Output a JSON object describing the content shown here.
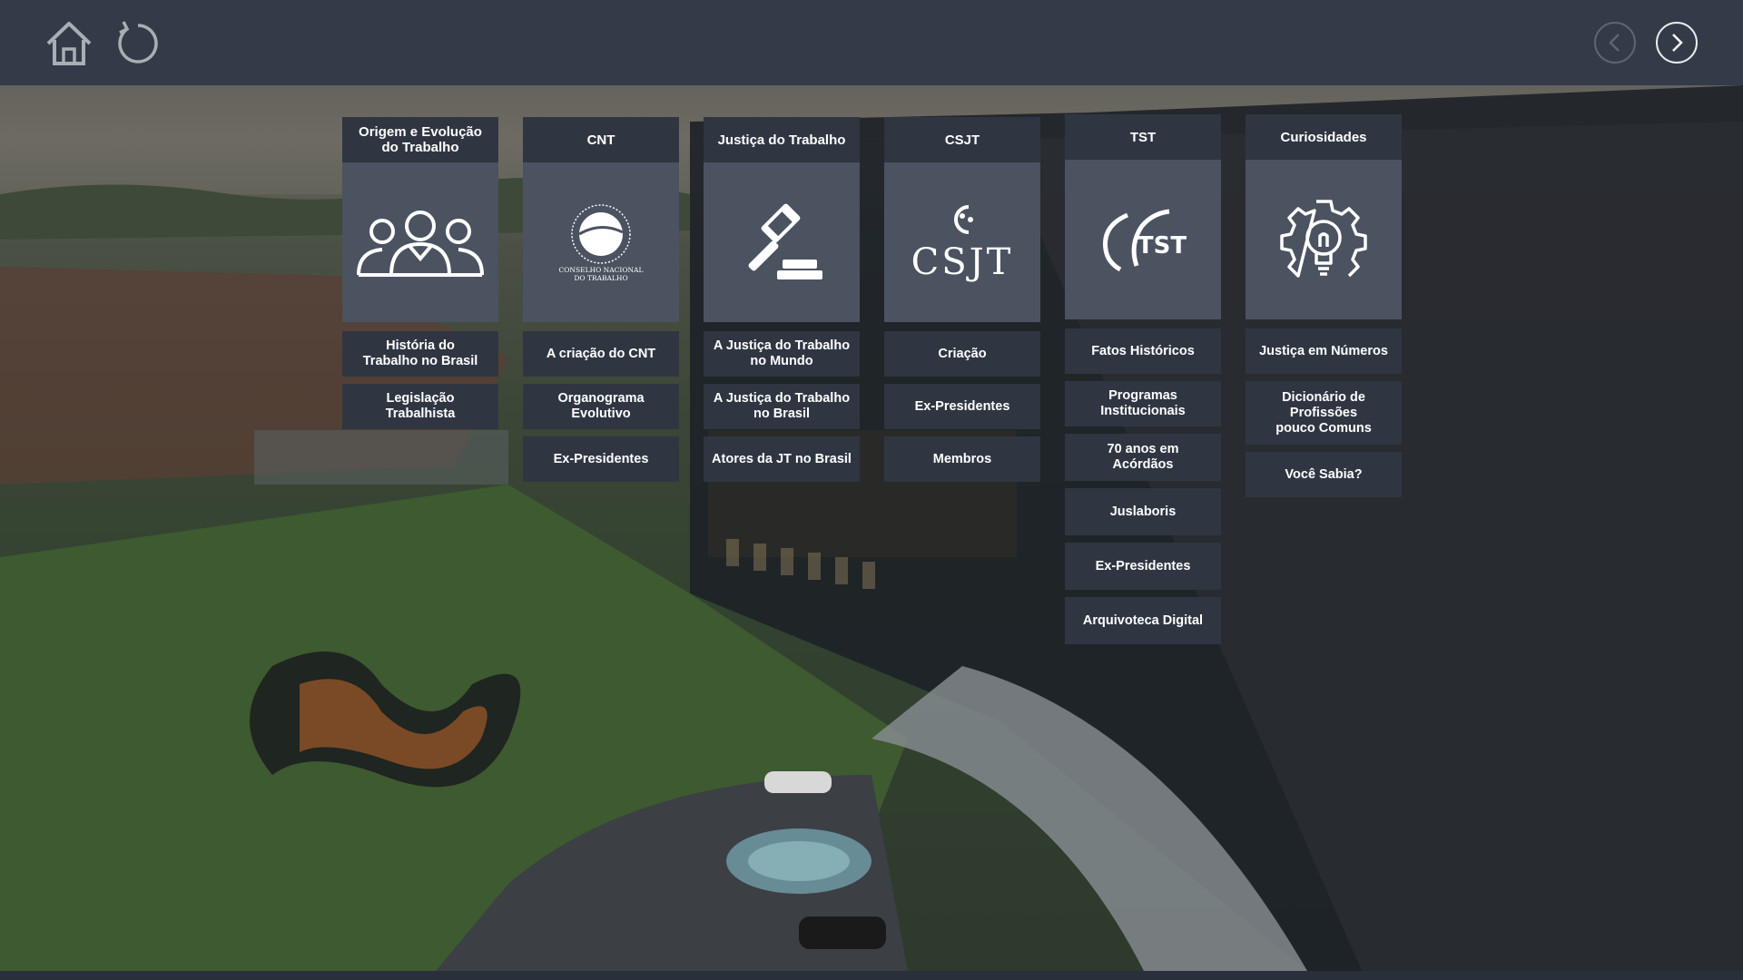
{
  "toolbar": {
    "home_icon": "home-icon",
    "refresh_icon": "refresh-icon",
    "prev_icon": "chevron-left-icon",
    "next_icon": "chevron-right-icon"
  },
  "columns": [
    {
      "title": "Origem e Evolução\ndo Trabalho",
      "icon": "people-icon",
      "items": [
        "História do\nTrabalho no Brasil",
        "Legislação\nTrabalhista"
      ]
    },
    {
      "title": "CNT",
      "icon": "cnt-seal-icon",
      "seal_text": "CONSELHO NACIONAL\nDO TRABALHO",
      "items": [
        "A criação do CNT",
        "Organograma\nEvolutivo",
        "Ex-Presidentes"
      ]
    },
    {
      "title": "Justiça do Trabalho",
      "icon": "gavel-icon",
      "items": [
        "A Justiça do Trabalho\nno Mundo",
        "A Justiça do Trabalho\nno Brasil",
        "Atores da JT no Brasil"
      ]
    },
    {
      "title": "CSJT",
      "icon": "csjt-logo-icon",
      "logo_text": "CSJT",
      "items": [
        "Criação",
        "Ex-Presidentes",
        "Membros"
      ]
    },
    {
      "title": "TST",
      "icon": "tst-logo-icon",
      "logo_text": "TST",
      "items": [
        "Fatos Históricos",
        "Programas\nInstitucionais",
        "70 anos em\nAcórdãos",
        "Juslaboris",
        "Ex-Presidentes",
        "Arquivoteca Digital"
      ]
    },
    {
      "title": "Curiosidades",
      "icon": "lightbulb-gear-icon",
      "items": [
        "Justiça em Números",
        "Dicionário de\nProfissões\npouco Comuns",
        "Você Sabia?"
      ]
    }
  ],
  "colors": {
    "topbar": "#333b48",
    "card_header": "#2f3642",
    "card_body": "#4b5260",
    "text": "#ffffff"
  }
}
